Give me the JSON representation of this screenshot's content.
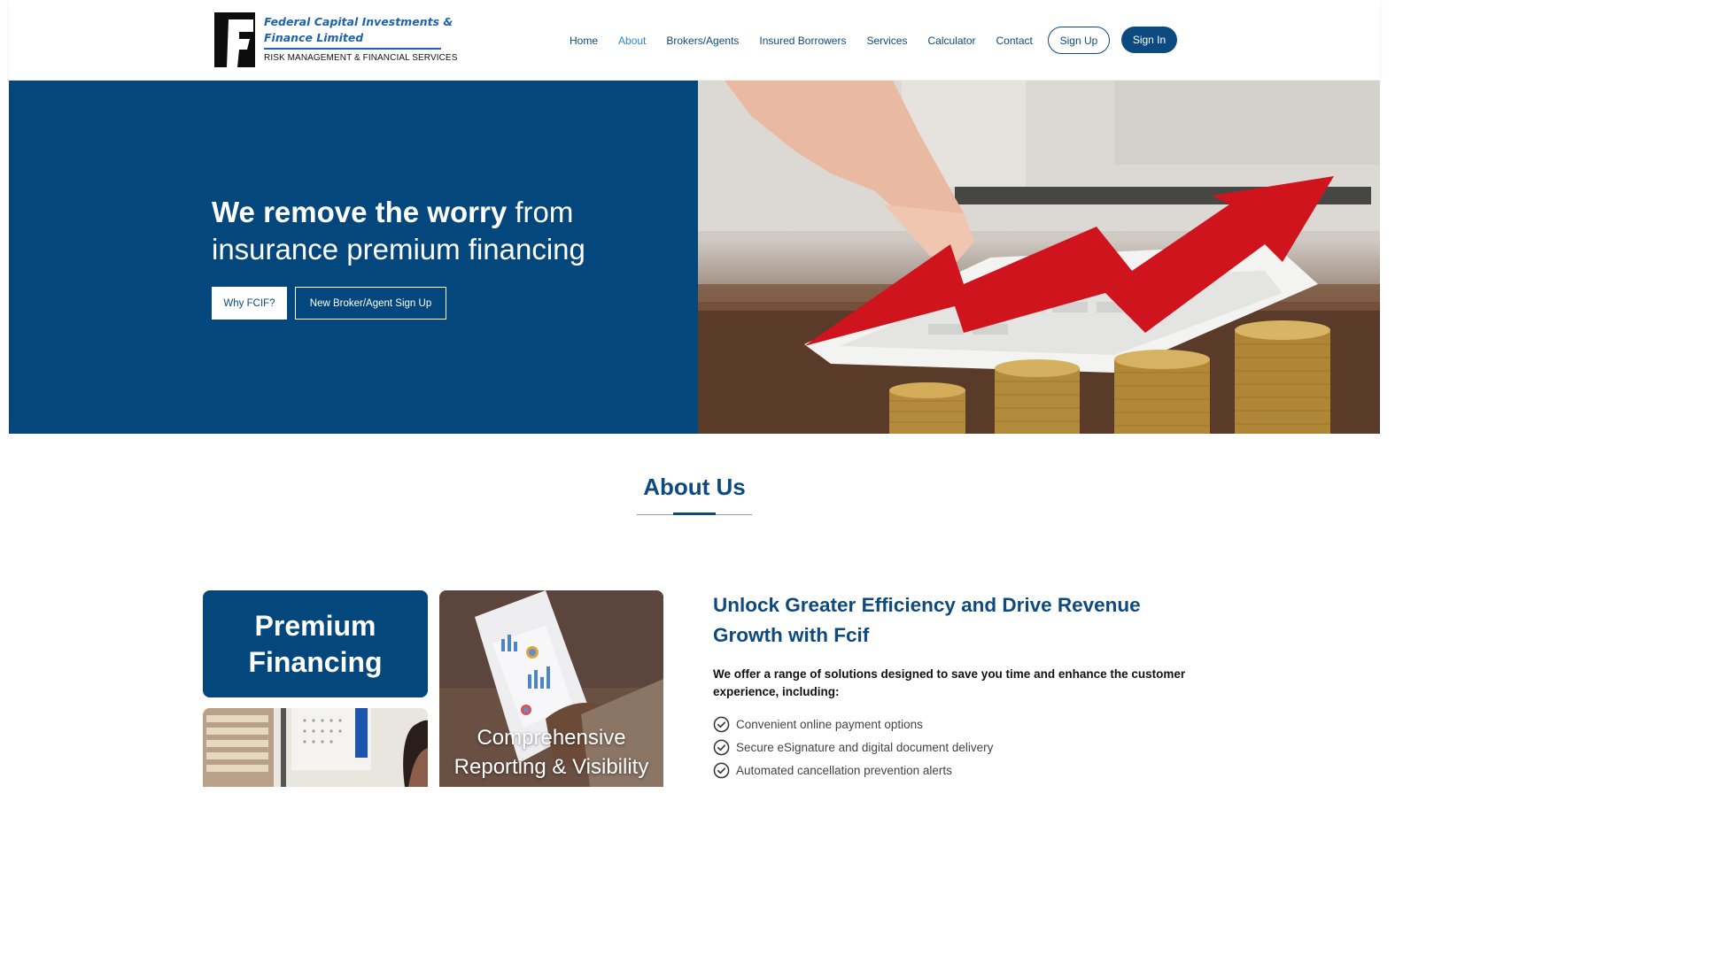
{
  "brand": {
    "name_line1": "Federal Capital Investments &",
    "name_line2": "Finance Limited",
    "tagline": "RISK MANAGEMENT & FINANCIAL SERVICES",
    "logo_icon": "fcif-logo-icon"
  },
  "nav": {
    "items": [
      {
        "label": "Home",
        "active": false
      },
      {
        "label": "About",
        "active": true
      },
      {
        "label": "Brokers/Agents",
        "active": false
      },
      {
        "label": "Insured Borrowers",
        "active": false
      },
      {
        "label": "Services",
        "active": false
      },
      {
        "label": "Calculator",
        "active": false
      },
      {
        "label": "Contact",
        "active": false
      }
    ],
    "signup_label": "Sign Up",
    "signin_label": "Sign In"
  },
  "hero": {
    "title_bold": "We remove the worry",
    "title_rest": " from insurance premium financing",
    "button_primary": "Why FCIF?",
    "button_secondary": "New Broker/Agent Sign Up",
    "image": "hand-placing-red-arrow-over-coin-stacks"
  },
  "about": {
    "title": "About Us",
    "card_premium": "Premium Financing",
    "card_reporting": "Comprehensive Reporting & Visibility",
    "heading": "Unlock Greater Efficiency and Drive Revenue Growth with Fcif",
    "intro": "We offer a range of solutions designed to save you time and enhance the customer experience, including:",
    "features": [
      "Convenient online payment options",
      "Secure eSignature and digital document delivery",
      "Automated cancellation prevention alerts"
    ]
  },
  "colors": {
    "primary": "#03477c",
    "nav_text": "#0c4a7f",
    "nav_active": "#2f86c8",
    "accent_arrow": "#d0141e"
  }
}
